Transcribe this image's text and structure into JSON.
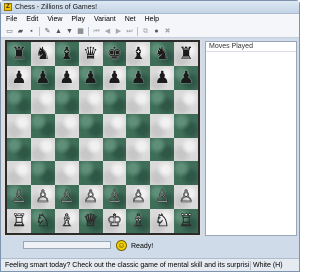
{
  "window": {
    "title": "Chess - Zillions of Games!",
    "app_icon": "Z"
  },
  "menu": [
    "File",
    "Edit",
    "View",
    "Play",
    "Variant",
    "Net",
    "Help"
  ],
  "toolbar": [
    {
      "name": "new-icon",
      "glyph": "▭",
      "disabled": false
    },
    {
      "name": "open-icon",
      "glyph": "▰",
      "disabled": false
    },
    {
      "name": "save-icon",
      "glyph": "▪",
      "disabled": false
    },
    {
      "sep": true
    },
    {
      "name": "pen-icon",
      "glyph": "✎",
      "disabled": false
    },
    {
      "name": "flip-up-icon",
      "glyph": "▲",
      "disabled": false
    },
    {
      "name": "flip-down-icon",
      "glyph": "▼",
      "disabled": false
    },
    {
      "name": "grid-icon",
      "glyph": "▦",
      "disabled": false
    },
    {
      "sep": true
    },
    {
      "name": "first-move-icon",
      "glyph": "⏮",
      "disabled": true
    },
    {
      "name": "back-icon",
      "glyph": "◀",
      "disabled": true
    },
    {
      "name": "forward-icon",
      "glyph": "▶",
      "disabled": true
    },
    {
      "name": "last-move-icon",
      "glyph": "⏭",
      "disabled": true
    },
    {
      "sep": true
    },
    {
      "name": "copy-icon",
      "glyph": "⧉",
      "disabled": true
    },
    {
      "name": "play-icon",
      "glyph": "●",
      "disabled": false
    },
    {
      "name": "stop-icon",
      "glyph": "✖",
      "disabled": true
    }
  ],
  "board": {
    "rows": [
      [
        "♜",
        "♞",
        "♝",
        "♛",
        "♚",
        "♝",
        "♞",
        "♜"
      ],
      [
        "♟",
        "♟",
        "♟",
        "♟",
        "♟",
        "♟",
        "♟",
        "♟"
      ],
      [
        "",
        "",
        "",
        "",
        "",
        "",
        "",
        ""
      ],
      [
        "",
        "",
        "",
        "",
        "",
        "",
        "",
        ""
      ],
      [
        "",
        "",
        "",
        "",
        "",
        "",
        "",
        ""
      ],
      [
        "",
        "",
        "",
        "",
        "",
        "",
        "",
        ""
      ],
      [
        "♙",
        "♙",
        "♙",
        "♙",
        "♙",
        "♙",
        "♙",
        "♙"
      ],
      [
        "♖",
        "♘",
        "♗",
        "♕",
        "♔",
        "♗",
        "♘",
        "♖"
      ]
    ],
    "black_pieces": "♜♞♝♛♚♟",
    "dark_color": "#3f6e58",
    "light_color": "#dadada"
  },
  "moves_panel": {
    "header": "Moves Played"
  },
  "status": {
    "ready": "Ready!",
    "message": "Feeling smart today? Check out the classic game of mental skill and its surprising vari",
    "turn": "White (H)"
  }
}
